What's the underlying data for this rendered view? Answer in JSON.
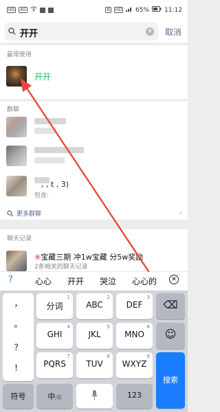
{
  "status_bar": {
    "left_chips": [
      "HD",
      "4G"
    ],
    "battery": "65%",
    "time": "11:12",
    "right_chips": [
      "N",
      "HD"
    ]
  },
  "search": {
    "query": "开开",
    "cancel_label": "取消"
  },
  "frequent": {
    "title": "最常使用",
    "contact_name": "开开"
  },
  "groups": {
    "title": "群聊",
    "visible_name_fragment": ", , t , 3)",
    "visible_sub": "包含:",
    "more_label": "更多群聊"
  },
  "chat_records": {
    "title": "聊天记录",
    "item_title": "宝藏三期 冲1w宝藏 分5w奖励",
    "item_sub": "2条相关的聊天记录"
  },
  "candidates": {
    "question": "?",
    "words": [
      "心心",
      "开开",
      "哭泣",
      "心心的"
    ],
    "close": "⊗"
  },
  "keyboard": {
    "symbols": [
      "，",
      "。",
      "？",
      "！"
    ],
    "rows": [
      [
        {
          "label": "分词",
          "num": "1"
        },
        {
          "label": "ABC",
          "num": "2"
        },
        {
          "label": "DEF",
          "num": "3"
        }
      ],
      [
        {
          "label": "GHI",
          "num": "4"
        },
        {
          "label": "JKL",
          "num": "5"
        },
        {
          "label": "MNO",
          "num": "6"
        }
      ],
      [
        {
          "label": "PQRS",
          "num": "7"
        },
        {
          "label": "TUV",
          "num": "8"
        },
        {
          "label": "WXYZ",
          "num": "9"
        }
      ]
    ],
    "backspace": "⌫",
    "emoji": "☺",
    "symbol_key": "符号",
    "lang_key": "中",
    "lang_sub": "/英",
    "zero_key": "123",
    "search_key": "搜索"
  },
  "colors": {
    "accent_green": "#07c160",
    "link_blue": "#576b95",
    "keyboard_blue": "#1a7cff",
    "arrow_red": "#e8473f"
  }
}
